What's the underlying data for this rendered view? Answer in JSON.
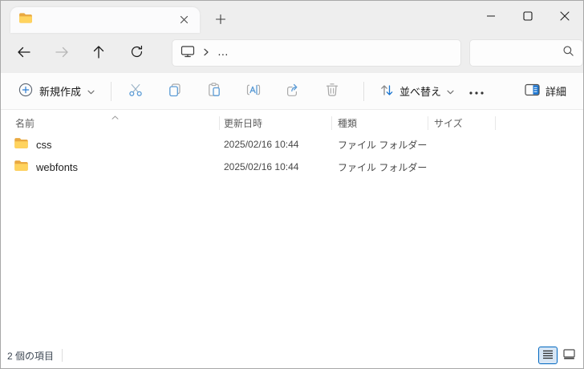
{
  "tab_bar": {
    "tab_icon": "folder-icon",
    "close_icon": "close-icon",
    "new_tab_icon": "plus-icon"
  },
  "window_controls": {
    "minimize": "minimize-icon",
    "maximize": "maximize-icon",
    "close": "close-icon"
  },
  "nav": {
    "back_icon": "arrow-left-icon",
    "forward_icon": "arrow-right-icon",
    "up_icon": "arrow-up-icon",
    "refresh_icon": "refresh-icon"
  },
  "address_bar": {
    "device_icon": "monitor-icon",
    "chevron_icon": "chevron-right-icon",
    "breadcrumb_ellipsis": "…"
  },
  "search": {
    "icon": "search-icon"
  },
  "toolbar": {
    "new_label": "新規作成",
    "sort_label": "並べ替え",
    "details_label": "詳細",
    "icons": [
      "new-icon",
      "cut-icon",
      "copy-icon",
      "paste-icon",
      "rename-icon",
      "share-icon",
      "delete-icon",
      "sort-icon",
      "see-more-icon",
      "details-pane-icon"
    ]
  },
  "columns": {
    "name": "名前",
    "date": "更新日時",
    "type": "種類",
    "size": "サイズ"
  },
  "files": [
    {
      "name": "css",
      "date": "2025/02/16 10:44",
      "type": "ファイル フォルダー",
      "size": ""
    },
    {
      "name": "webfonts",
      "date": "2025/02/16 10:44",
      "type": "ファイル フォルダー",
      "size": ""
    }
  ],
  "status_bar": {
    "item_count": "2 個の項目"
  },
  "colors": {
    "titlebar_bg": "#eeeeee",
    "accent_blue": "#0067c0",
    "toolbar_icon_blue": "#64a7dc",
    "disabled_gray": "#a6a6a6",
    "folder_front": "#ffd35e",
    "folder_back": "#e9a941"
  }
}
